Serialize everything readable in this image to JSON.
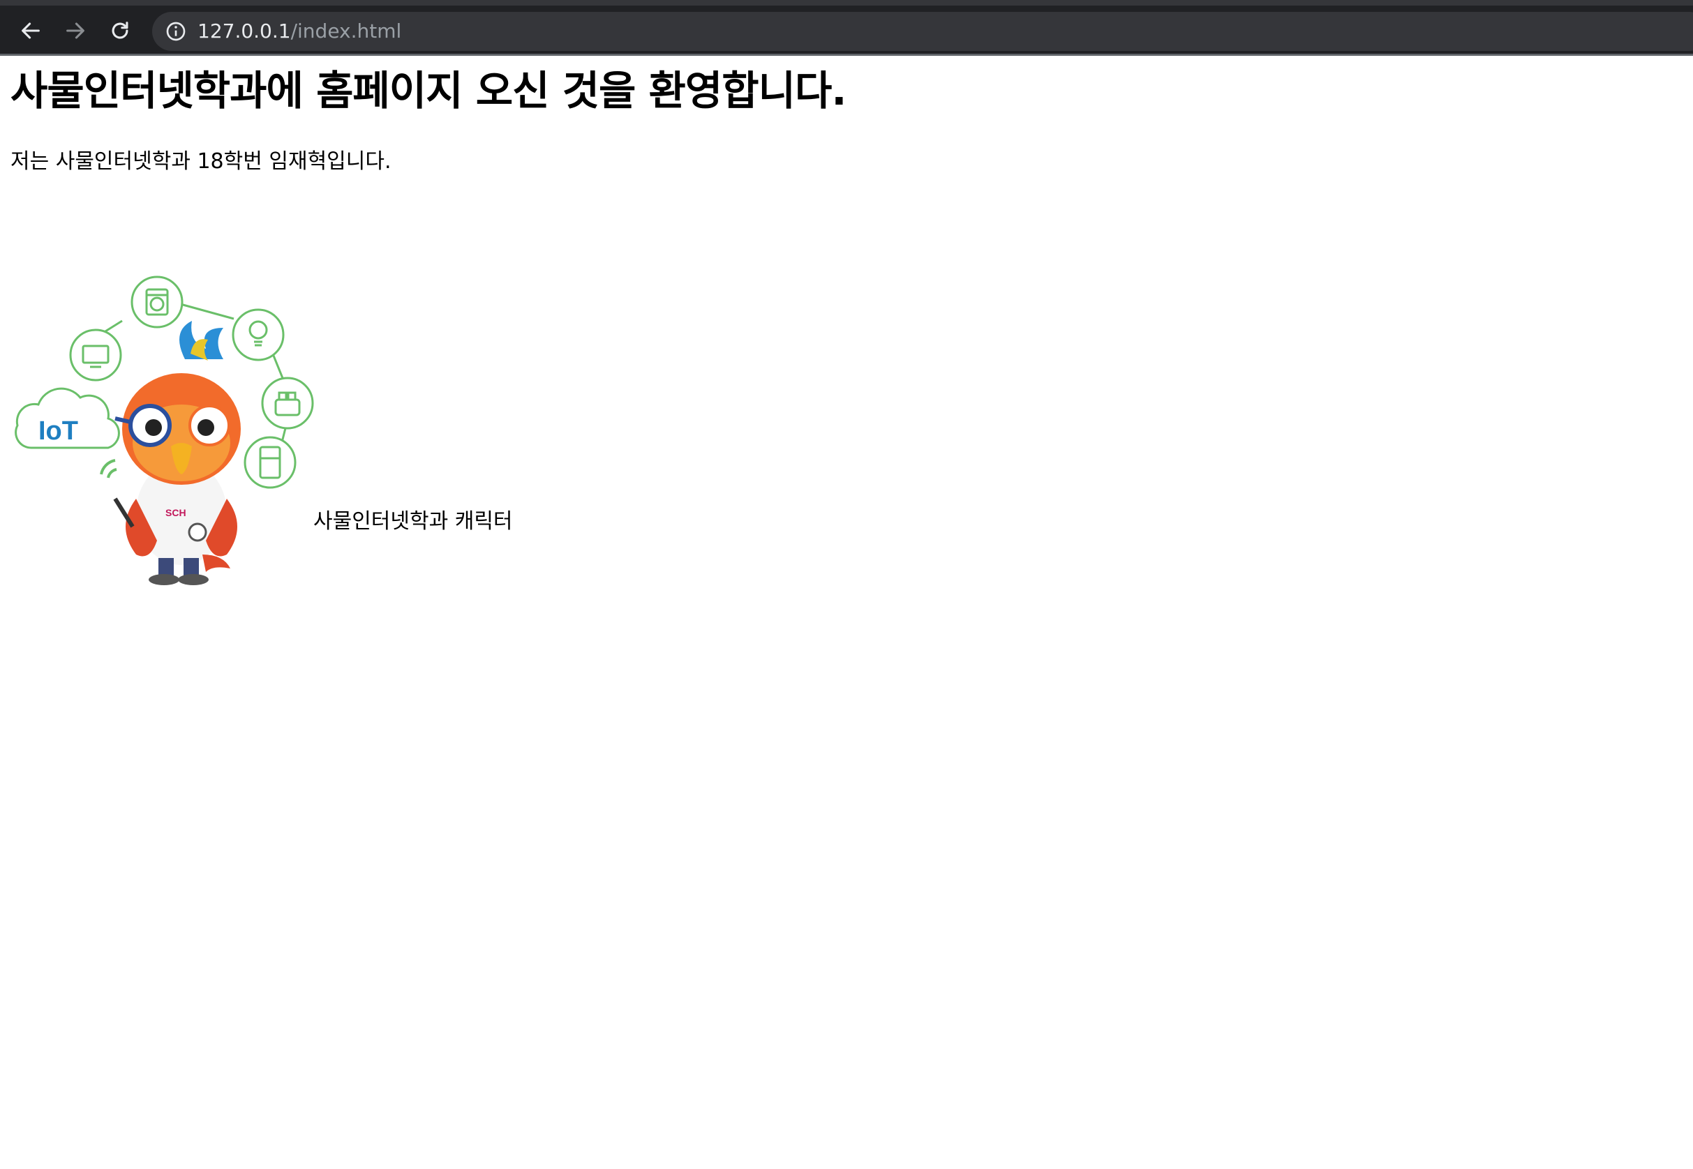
{
  "browser": {
    "url_host": "127.0.0.1",
    "url_path": "/index.html"
  },
  "page": {
    "heading": "사물인터넷학과에 홈페이지 오신 것을 환영합니다.",
    "intro": "저는 사물인터넷학과 18학번 임재혁입니다.",
    "image_logo_text": "IoT",
    "image_badge_text": "SCH",
    "caption": "사물인터넷학과 캐릭터"
  },
  "colors": {
    "browser_bg": "#202124",
    "omnibox_bg": "#35363a",
    "icon_green": "#6abf69",
    "iot_blue": "#1f7fc1"
  },
  "icons": [
    "back-arrow-icon",
    "forward-arrow-icon",
    "reload-icon",
    "info-icon"
  ]
}
